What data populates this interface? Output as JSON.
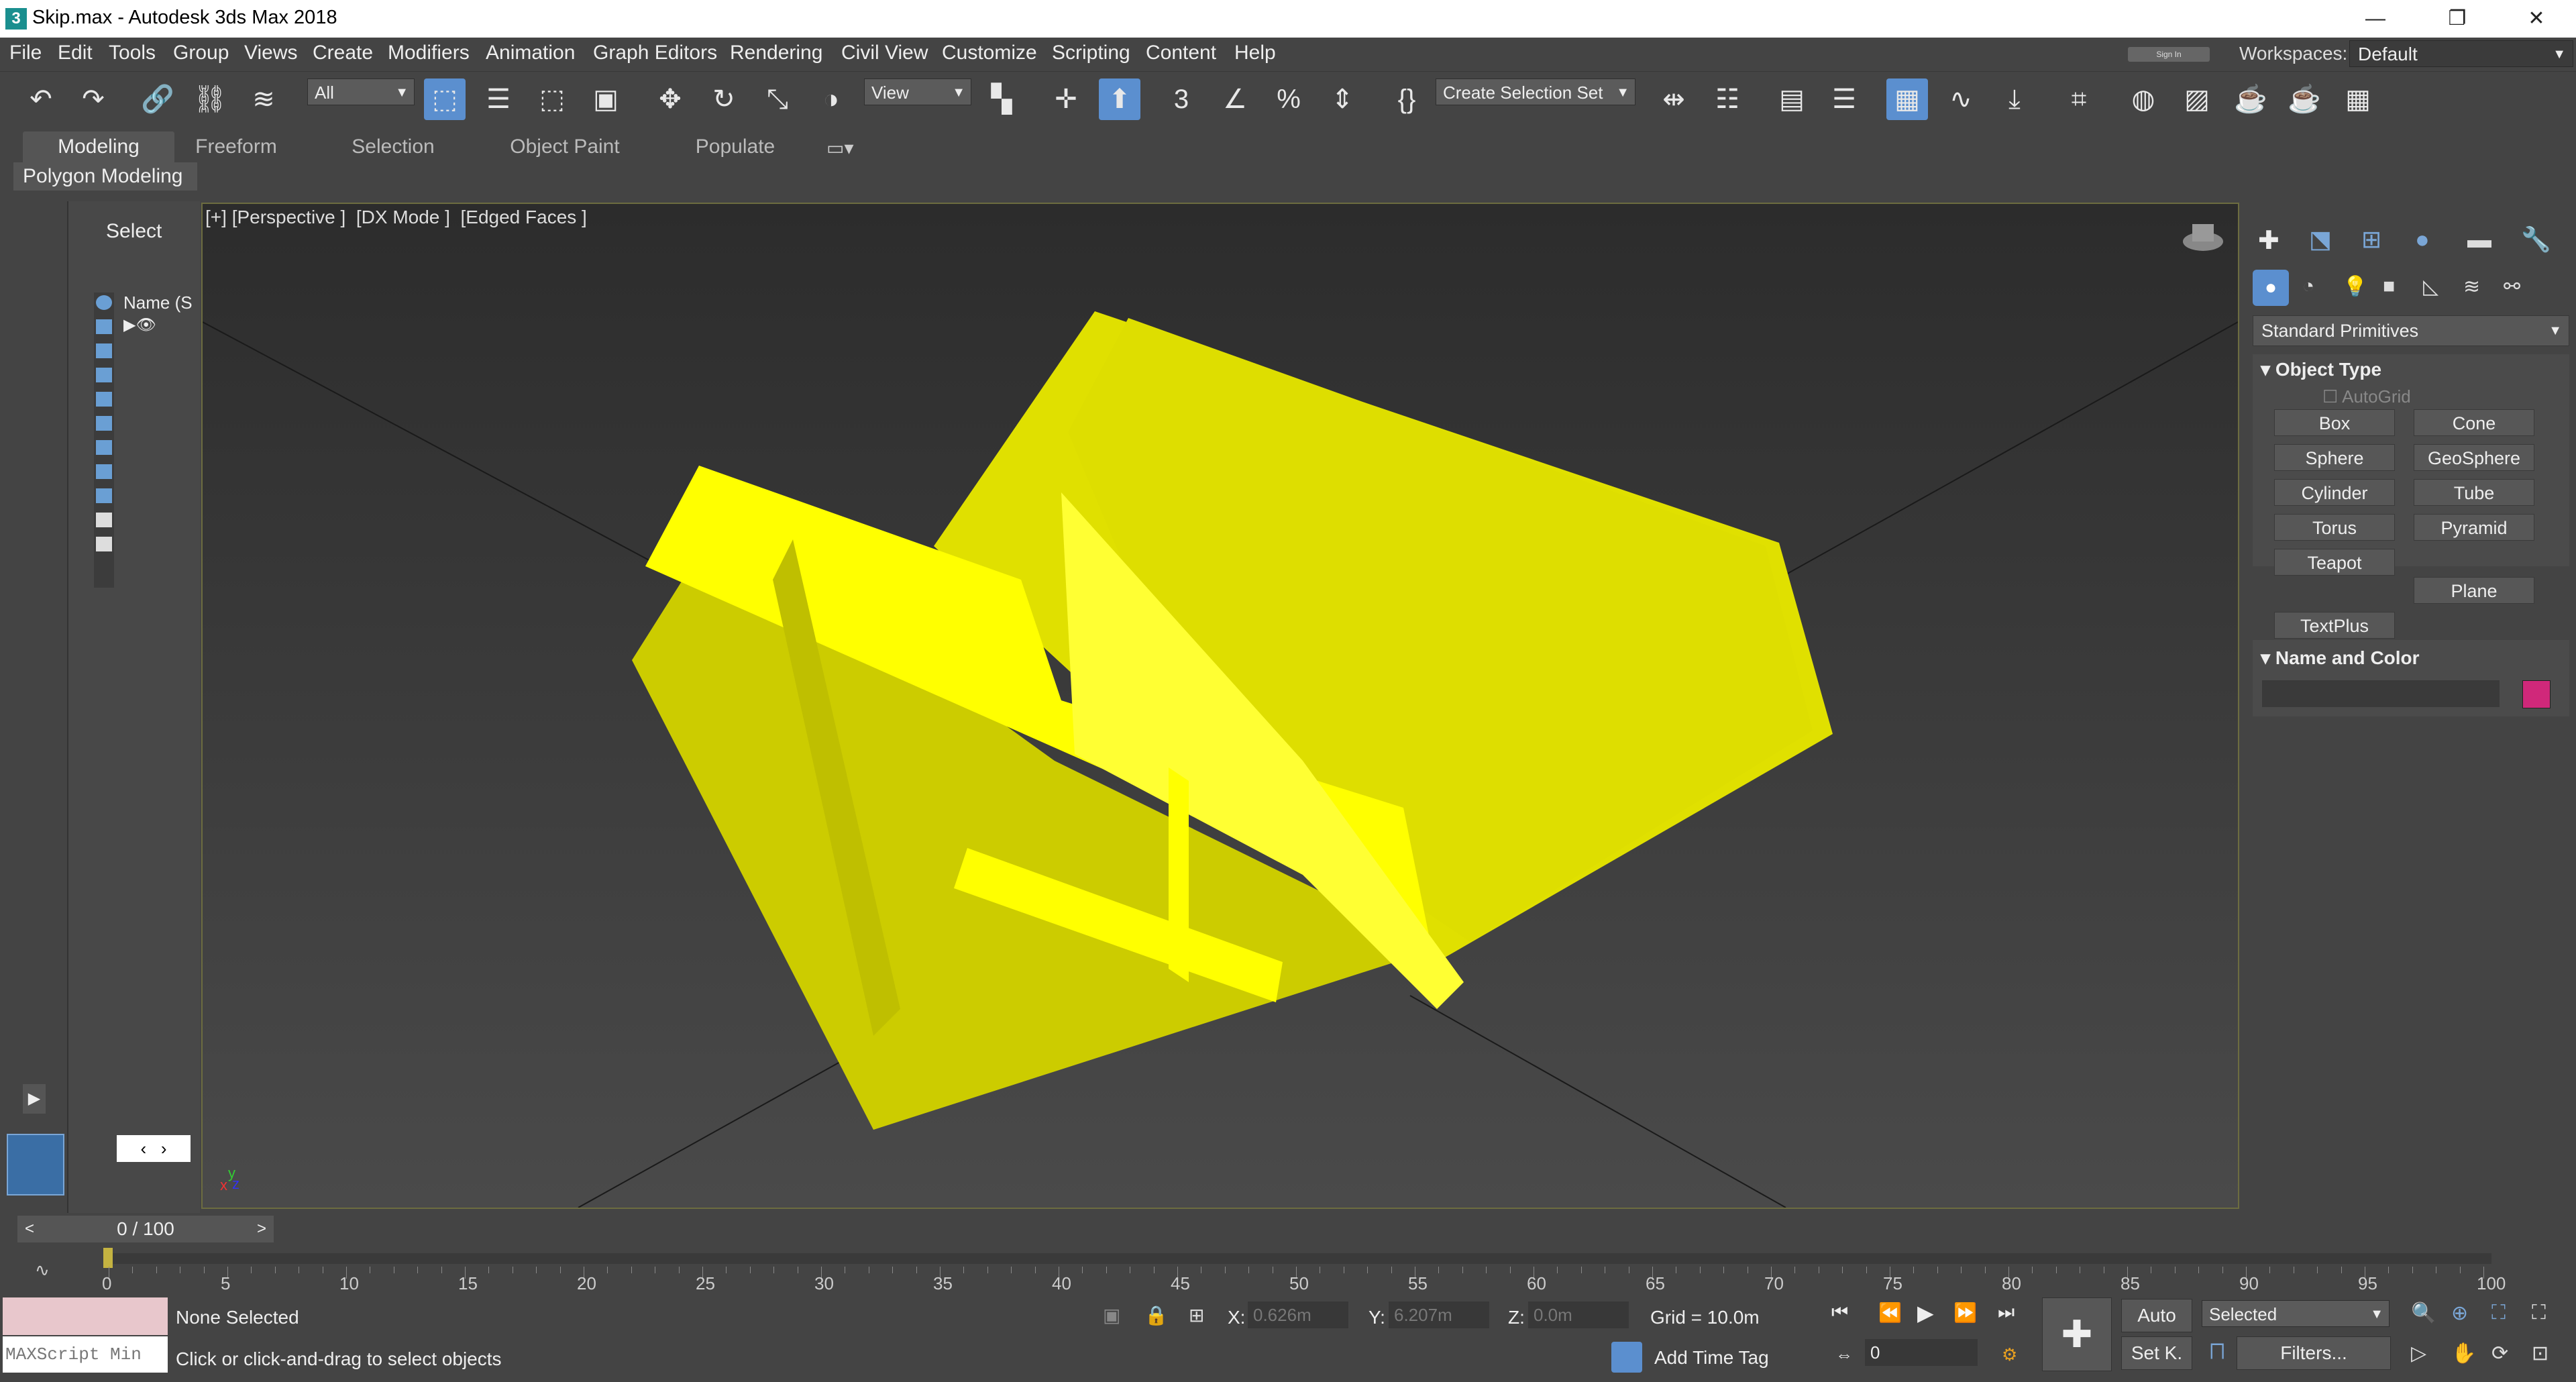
{
  "window": {
    "title": "Skip.max - Autodesk 3ds Max 2018",
    "app_icon": "3"
  },
  "menu": [
    "File",
    "Edit",
    "Tools",
    "Group",
    "Views",
    "Create",
    "Modifiers",
    "Animation",
    "Graph Editors",
    "Rendering",
    "Civil View",
    "Customize",
    "Scripting",
    "Content",
    "Help"
  ],
  "signin": "Sign In",
  "workspaces": {
    "label": "Workspaces:",
    "value": "Default"
  },
  "toolbar": {
    "filter": "All",
    "ref_coord": "View",
    "selection_set": "Create Selection Set"
  },
  "ribbon": {
    "tabs": [
      "Modeling",
      "Freeform",
      "Selection",
      "Object Paint",
      "Populate"
    ],
    "active": "Modeling",
    "subtab": "Polygon Modeling"
  },
  "scene_explorer": {
    "select_label": "Select",
    "name_header": "Name (S"
  },
  "viewport": {
    "label": "[+] [Perspective ]  [DX Mode ]  [Edged Faces ]",
    "object_color": "#ffff00"
  },
  "command_panel": {
    "dropdown": "Standard Primitives",
    "object_type_title": "Object Type",
    "autogrid": "AutoGrid",
    "buttons": [
      "Box",
      "Cone",
      "Sphere",
      "GeoSphere",
      "Cylinder",
      "Tube",
      "Torus",
      "Pyramid",
      "Teapot",
      "Plane",
      "TextPlus"
    ],
    "name_color_title": "Name and Color",
    "swatch_color": "#d0287a"
  },
  "timeline": {
    "frame_display": "0 / 100",
    "ticks": [
      "0",
      "5",
      "10",
      "15",
      "20",
      "25",
      "30",
      "35",
      "40",
      "45",
      "50",
      "55",
      "60",
      "65",
      "70",
      "75",
      "80",
      "85",
      "90",
      "95",
      "100"
    ]
  },
  "status": {
    "maxscript_placeholder": "MAXScript Min",
    "selection": "None Selected",
    "prompt": "Click or click-and-drag to select objects",
    "x_label": "X:",
    "x_value": "0.626m",
    "y_label": "Y:",
    "y_value": "6.207m",
    "z_label": "Z:",
    "z_value": "0.0m",
    "grid": "Grid = 10.0m",
    "add_time_tag": "Add Time Tag",
    "auto": "Auto",
    "set_key": "Set K.",
    "selected": "Selected",
    "filters": "Filters...",
    "frame": "0"
  }
}
